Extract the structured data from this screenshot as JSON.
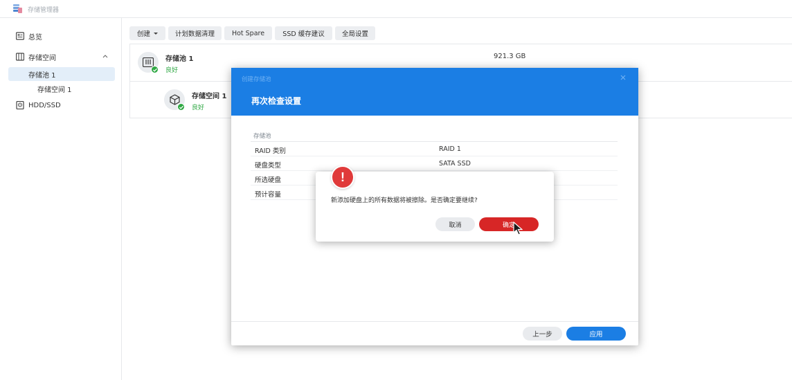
{
  "app": {
    "title": "存储管理器"
  },
  "sidebar": {
    "items": [
      {
        "label": "总览"
      },
      {
        "label": "存储空间"
      },
      {
        "label": "存储池 1"
      },
      {
        "label": "存储空间 1"
      },
      {
        "label": "HDD/SSD"
      }
    ]
  },
  "toolbar": {
    "create_label": "创建",
    "scrub_label": "计划数据清理",
    "hotspare_label": "Hot Spare",
    "ssd_cache_label": "SSD 缓存建议",
    "global_label": "全局设置"
  },
  "pool": {
    "name": "存储池 1",
    "status": "良好",
    "size": "921.3 GB",
    "volume_name": "存储空间 1",
    "volume_status": "良好"
  },
  "wizard": {
    "small_title": "创建存储池",
    "title": "再次检查设置",
    "section": "存储池",
    "rows": [
      {
        "key": "RAID 类别",
        "value": "RAID 1"
      },
      {
        "key": "硬盘类型",
        "value": "SATA SSD"
      },
      {
        "key": "所选硬盘",
        "value": ""
      },
      {
        "key": "预计容量",
        "value": ""
      }
    ],
    "prev_label": "上一步",
    "apply_label": "应用"
  },
  "confirm": {
    "message": "新添加硬盘上的所有数据将被擦除。是否确定要继续?",
    "cancel_label": "取消",
    "ok_label": "确定"
  },
  "colors": {
    "accent": "#1b7ee4",
    "danger": "#d72626",
    "success": "#2ea843"
  }
}
